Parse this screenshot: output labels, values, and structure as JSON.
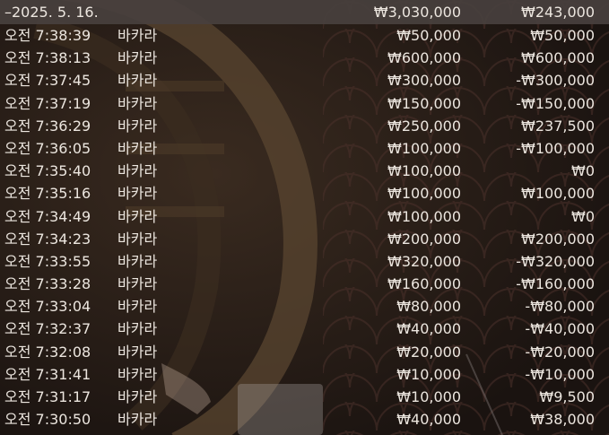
{
  "summary": {
    "date": "–2025. 5. 16.",
    "total_bet": "₩3,030,000",
    "total_result": "₩243,000"
  },
  "rows": [
    {
      "time": "오전 7:38:39",
      "game": "바카라",
      "bet": "₩50,000",
      "result": "₩50,000"
    },
    {
      "time": "오전 7:38:13",
      "game": "바카라",
      "bet": "₩600,000",
      "result": "₩600,000"
    },
    {
      "time": "오전 7:37:45",
      "game": "바카라",
      "bet": "₩300,000",
      "result": "-₩300,000"
    },
    {
      "time": "오전 7:37:19",
      "game": "바카라",
      "bet": "₩150,000",
      "result": "-₩150,000"
    },
    {
      "time": "오전 7:36:29",
      "game": "바카라",
      "bet": "₩250,000",
      "result": "₩237,500"
    },
    {
      "time": "오전 7:36:05",
      "game": "바카라",
      "bet": "₩100,000",
      "result": "-₩100,000"
    },
    {
      "time": "오전 7:35:40",
      "game": "바카라",
      "bet": "₩100,000",
      "result": "₩0"
    },
    {
      "time": "오전 7:35:16",
      "game": "바카라",
      "bet": "₩100,000",
      "result": "₩100,000"
    },
    {
      "time": "오전 7:34:49",
      "game": "바카라",
      "bet": "₩100,000",
      "result": "₩0"
    },
    {
      "time": "오전 7:34:23",
      "game": "바카라",
      "bet": "₩200,000",
      "result": "₩200,000"
    },
    {
      "time": "오전 7:33:55",
      "game": "바카라",
      "bet": "₩320,000",
      "result": "-₩320,000"
    },
    {
      "time": "오전 7:33:28",
      "game": "바카라",
      "bet": "₩160,000",
      "result": "-₩160,000"
    },
    {
      "time": "오전 7:33:04",
      "game": "바카라",
      "bet": "₩80,000",
      "result": "-₩80,000"
    },
    {
      "time": "오전 7:32:37",
      "game": "바카라",
      "bet": "₩40,000",
      "result": "-₩40,000"
    },
    {
      "time": "오전 7:32:08",
      "game": "바카라",
      "bet": "₩20,000",
      "result": "-₩20,000"
    },
    {
      "time": "오전 7:31:41",
      "game": "바카라",
      "bet": "₩10,000",
      "result": "-₩10,000"
    },
    {
      "time": "오전 7:31:17",
      "game": "바카라",
      "bet": "₩10,000",
      "result": "₩9,500"
    },
    {
      "time": "오전 7:30:50",
      "game": "바카라",
      "bet": "₩40,000",
      "result": "₩38,000"
    }
  ]
}
